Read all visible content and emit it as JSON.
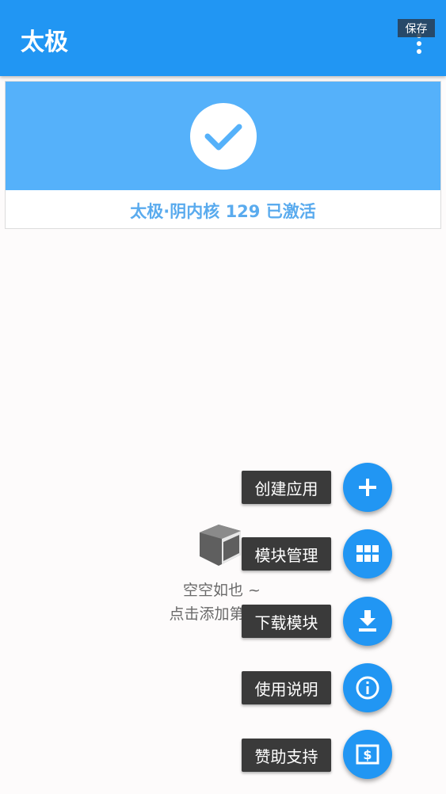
{
  "appbar": {
    "title": "太极",
    "menu_icon": "more-vert-icon",
    "tooltip": "保存",
    "color": "#2196f3"
  },
  "status": {
    "icon": "check-icon",
    "text": "太极·阴内核 129 已激活",
    "banner_color": "#55b1fa"
  },
  "empty_state": {
    "icon": "box-icon",
    "title": "空空如也 ~",
    "subtitle": "点击添加第一个"
  },
  "fab_menu": [
    {
      "label": "创建应用",
      "icon": "plus-icon"
    },
    {
      "label": "模块管理",
      "icon": "grid-icon"
    },
    {
      "label": "下载模块",
      "icon": "download-icon"
    },
    {
      "label": "使用说明",
      "icon": "info-icon"
    },
    {
      "label": "赞助支持",
      "icon": "dollar-icon"
    }
  ]
}
